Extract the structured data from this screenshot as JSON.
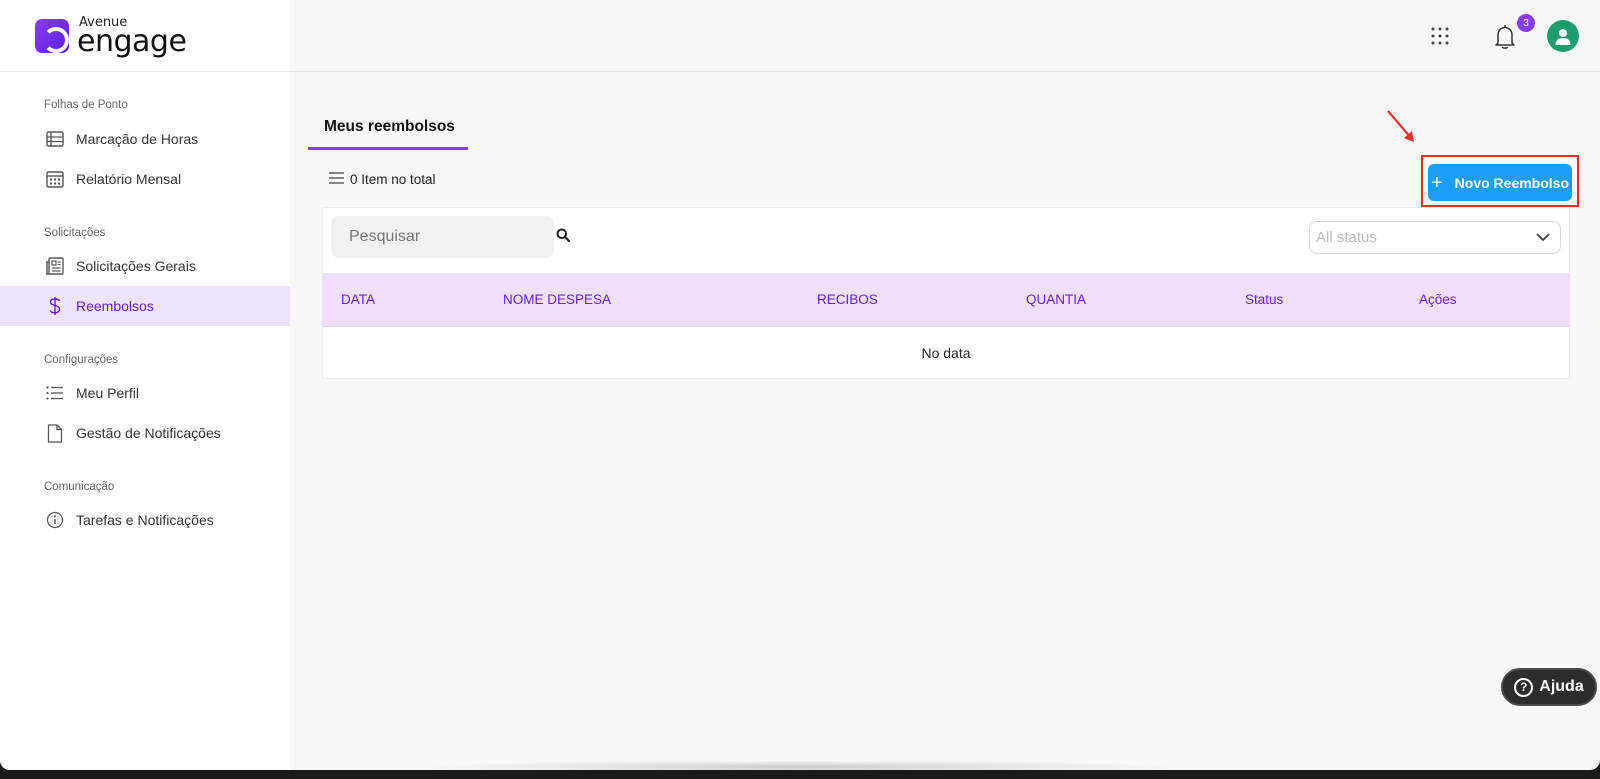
{
  "brand": {
    "small": "Avenue",
    "big": "engage"
  },
  "header": {
    "notification_count": "3"
  },
  "sidebar": {
    "sections": [
      {
        "title": "Folhas de Ponto",
        "items": [
          {
            "label": "Marcação de Horas",
            "icon": "clock-list-icon"
          },
          {
            "label": "Relatório Mensal",
            "icon": "calendar-icon"
          }
        ]
      },
      {
        "title": "Solicitações",
        "items": [
          {
            "label": "Solicitações Gerais",
            "icon": "document-list-icon"
          },
          {
            "label": "Reembolsos",
            "icon": "dollar-icon",
            "active": true
          }
        ]
      },
      {
        "title": "Configurações",
        "items": [
          {
            "label": "Meu Perfil",
            "icon": "list-icon"
          },
          {
            "label": "Gestão de Notificações",
            "icon": "file-icon"
          }
        ]
      },
      {
        "title": "Comunicação",
        "items": [
          {
            "label": "Tarefas e Notificações",
            "icon": "info-icon"
          }
        ]
      }
    ]
  },
  "main": {
    "tab_label": "Meus reembolsos",
    "item_count": "0 Item no total",
    "new_button_label": "Novo Reembolso",
    "search_placeholder": "Pesquisar",
    "status_placeholder": "All status",
    "table": {
      "headers": [
        "DATA",
        "NOME DESPESA",
        "RECIBOS",
        "QUANTIA",
        "Status",
        "Ações"
      ],
      "empty_text": "No data"
    }
  },
  "help_label": "Ajuda",
  "colors": {
    "accent": "#8b3dff",
    "button": "#1b9ef5",
    "active_bg": "#ede3fd",
    "annotation": "#e53030"
  }
}
